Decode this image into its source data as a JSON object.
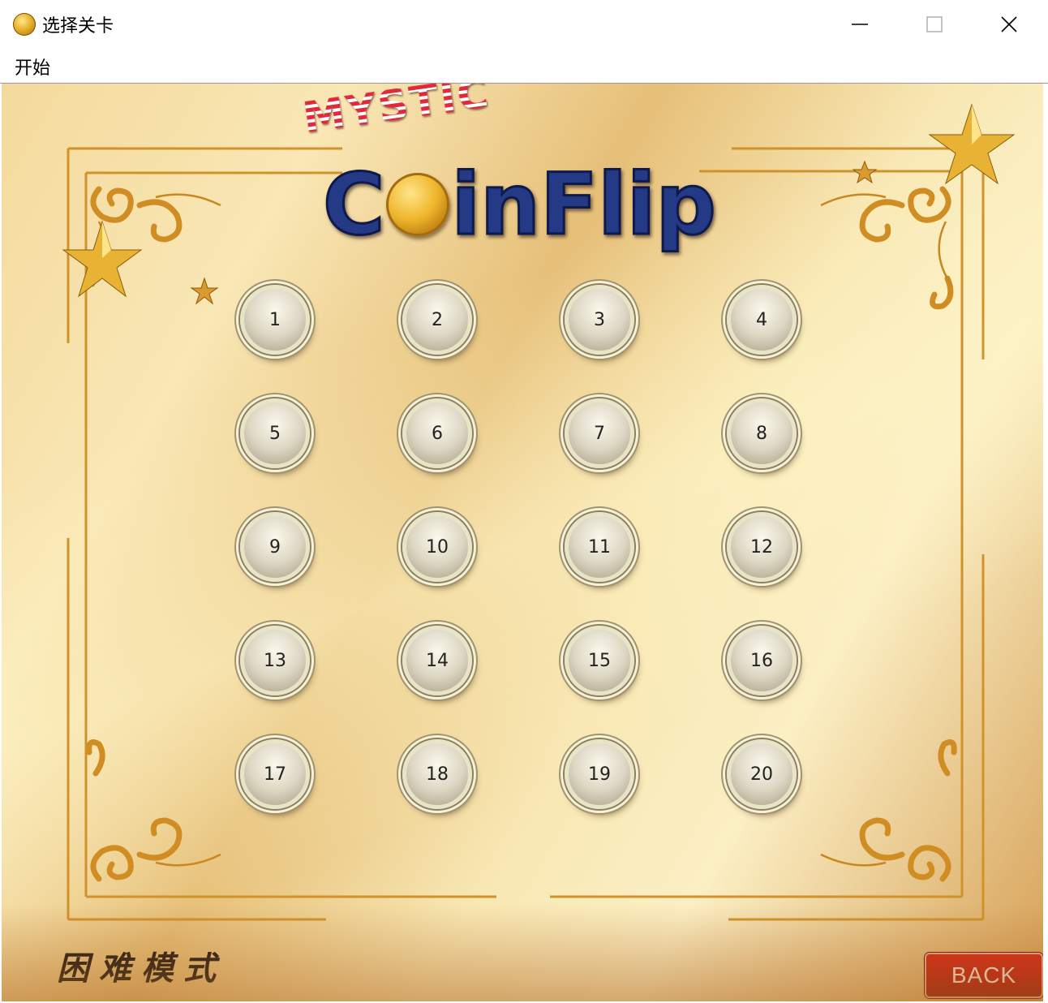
{
  "window": {
    "title": "选择关卡"
  },
  "menu": {
    "items": [
      "开始"
    ]
  },
  "logo": {
    "top_word": "MYSTIC",
    "letters": [
      "C",
      "i",
      "n",
      "F",
      "l",
      "i",
      "p"
    ]
  },
  "levels": [
    "1",
    "2",
    "3",
    "4",
    "5",
    "6",
    "7",
    "8",
    "9",
    "10",
    "11",
    "12",
    "13",
    "14",
    "15",
    "16",
    "17",
    "18",
    "19",
    "20"
  ],
  "mode_label": "困难模式",
  "back_label": "BACK",
  "colors": {
    "back_button": "#c0140c",
    "frame_gold": "#d99a2e",
    "logo_blue": "#243a86",
    "logo_red": "#e02a3a"
  }
}
